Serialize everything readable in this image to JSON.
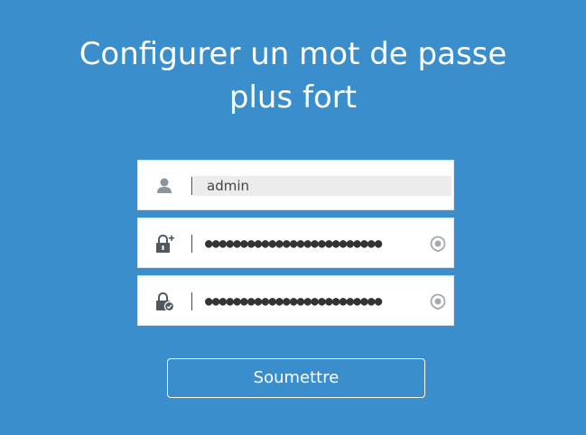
{
  "title_line1": "Configurer un mot de passe",
  "title_line2": "plus fort",
  "fields": {
    "username": {
      "icon": "user-icon",
      "value": "admin"
    },
    "new_password": {
      "icon": "lock-plus-icon",
      "masked_value": "●●●●●●●●●●●●●●●●●●●●●●●●●",
      "toggle_icon": "reveal-password-icon"
    },
    "confirm_password": {
      "icon": "lock-check-icon",
      "masked_value": "●●●●●●●●●●●●●●●●●●●●●●●●●",
      "toggle_icon": "reveal-password-icon"
    }
  },
  "submit_label": "Soumettre",
  "colors": {
    "background": "#3b8ecc",
    "field_background": "#ffffff",
    "username_fill": "#ececec",
    "icon": "#5b6670",
    "text": "#ffffff"
  }
}
